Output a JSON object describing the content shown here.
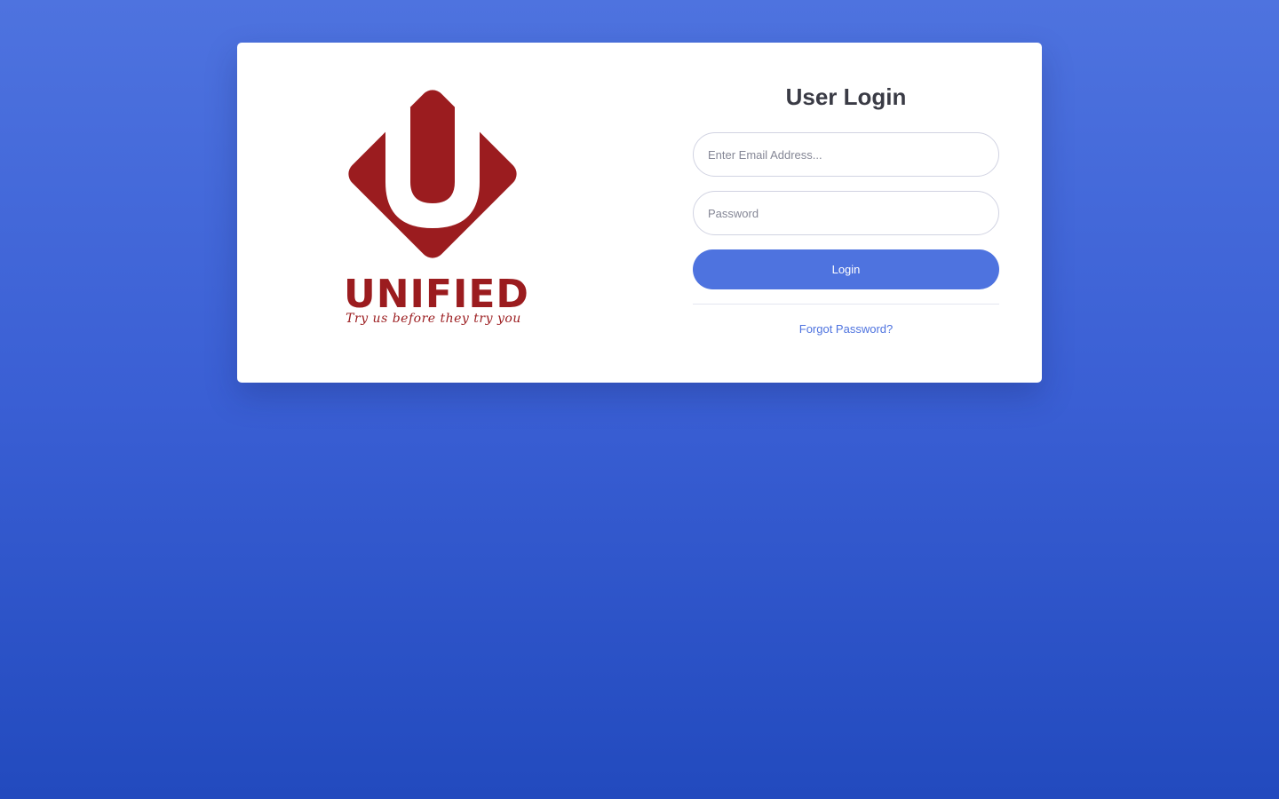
{
  "brand": {
    "name": "UNIFIED",
    "tagline": "Try us before they try you",
    "color": "#9b1c1f"
  },
  "login": {
    "title": "User Login",
    "email_placeholder": "Enter Email Address...",
    "password_placeholder": "Password",
    "submit_label": "Login",
    "forgot_label": "Forgot Password?"
  },
  "theme": {
    "accent": "#4e73df",
    "background_top": "#4e73df",
    "background_bottom": "#224abe"
  }
}
